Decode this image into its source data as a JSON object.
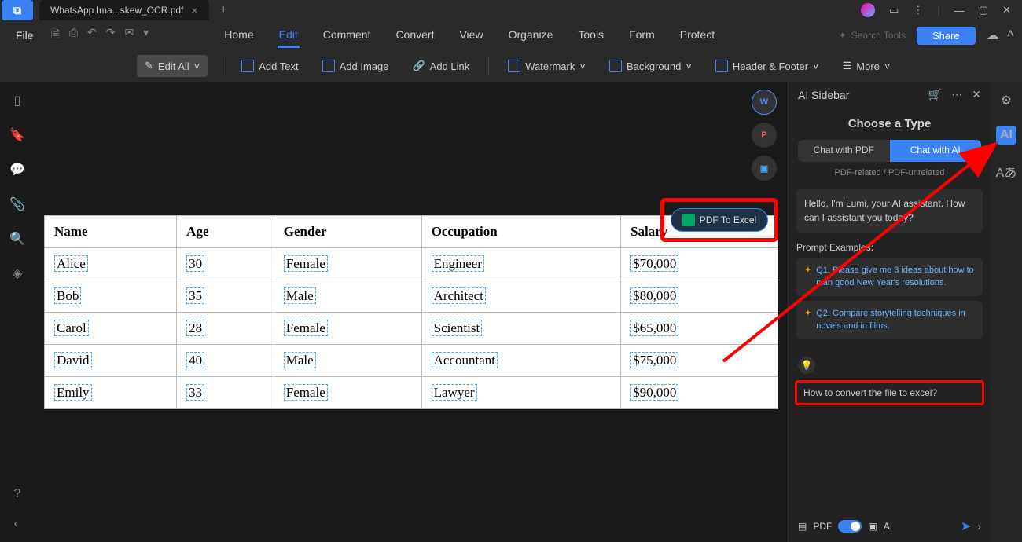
{
  "tab": {
    "title": "WhatsApp Ima...skew_OCR.pdf"
  },
  "menu": {
    "file": "File",
    "tabs": [
      "Home",
      "Edit",
      "Comment",
      "Convert",
      "View",
      "Organize",
      "Tools",
      "Form",
      "Protect"
    ],
    "active": "Edit",
    "search_placeholder": "Search Tools",
    "share": "Share"
  },
  "toolbar": {
    "edit_all": "Edit All",
    "add_text": "Add Text",
    "add_image": "Add Image",
    "add_link": "Add Link",
    "watermark": "Watermark",
    "background": "Background",
    "header_footer": "Header & Footer",
    "more": "More"
  },
  "pdf_excel_btn": "PDF To Excel",
  "table": {
    "headers": [
      "Name",
      "Age",
      "Gender",
      "Occupation",
      "Salary"
    ],
    "rows": [
      [
        "Alice",
        "30",
        "Female",
        "Engineer",
        "$70,000"
      ],
      [
        "Bob",
        "35",
        "Male",
        "Architect",
        "$80,000"
      ],
      [
        "Carol",
        "28",
        "Female",
        "Scientist",
        "$65,000"
      ],
      [
        "David",
        "40",
        "Male",
        "Accountant",
        "$75,000"
      ],
      [
        "Emily",
        "33",
        "Female",
        "Lawyer",
        "$90,000"
      ]
    ]
  },
  "sidebar": {
    "title": "AI Sidebar",
    "choose": "Choose a Type",
    "chat_pdf": "Chat with PDF",
    "chat_ai": "Chat with AI",
    "related": "PDF-related / PDF-unrelated",
    "greeting": "Hello, I'm Lumi, your AI assistant. How can I assistant you today?",
    "prompt_title": "Prompt Examples:",
    "prompt1": "Q1. Please give me 3 ideas about how to plan good New Year's resolutions.",
    "prompt2": "Q2. Compare storytelling techniques in novels and in films.",
    "input_text": "How to convert the file to excel?",
    "pdf_label": "PDF",
    "ai_label": "AI"
  }
}
